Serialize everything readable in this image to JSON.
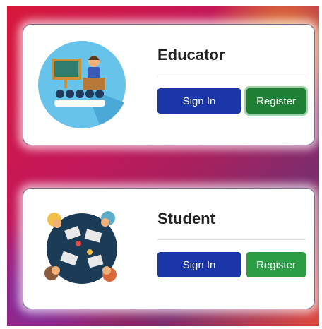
{
  "cards": [
    {
      "title": "Educator",
      "signin_label": "Sign In",
      "register_label": "Register"
    },
    {
      "title": "Student",
      "signin_label": "Sign In",
      "register_label": "Register"
    }
  ],
  "colors": {
    "signin": "#1a36a8",
    "register": "#2a9d45",
    "register_focused": "#1f7f34"
  },
  "icons": {
    "educator": "teacher-presenting-icon",
    "student": "students-around-table-icon"
  }
}
